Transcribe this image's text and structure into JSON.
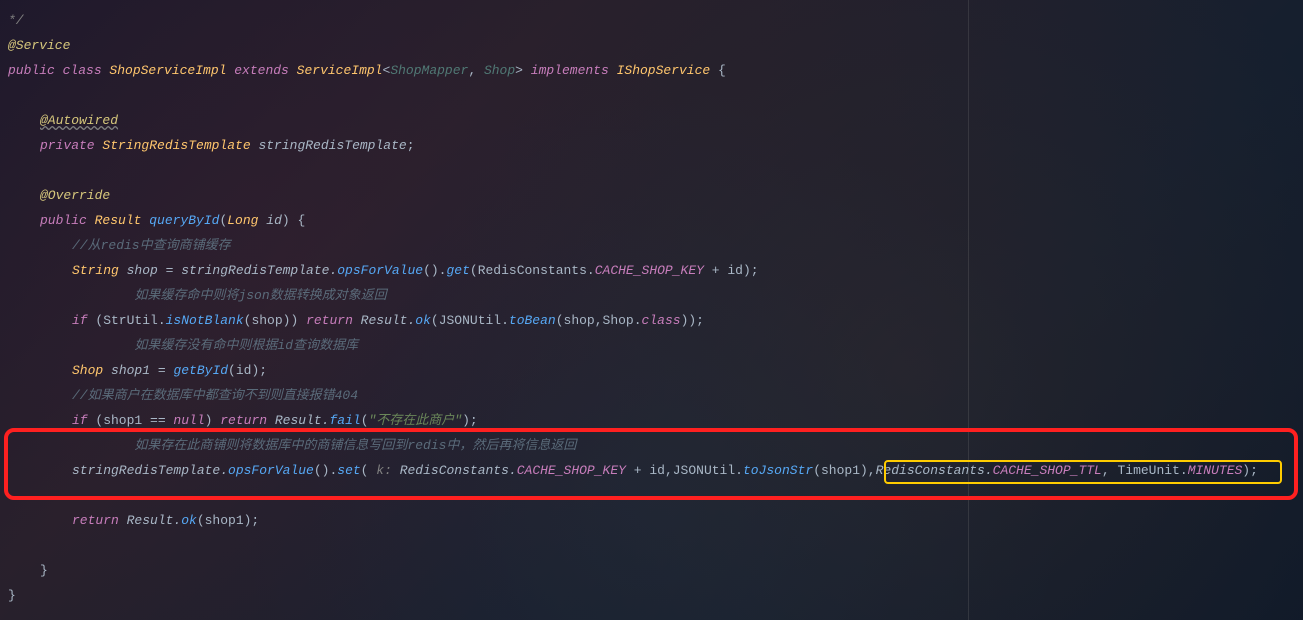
{
  "code": {
    "l1": "*/",
    "l2_anno": "@Service",
    "l3_pub": "public ",
    "l3_class": "class ",
    "l3_name": "ShopServiceImpl ",
    "l3_ext": "extends ",
    "l3_si": "ServiceImpl",
    "l3_lt": "<",
    "l3_sm": "ShopMapper",
    "l3_c1": ", ",
    "l3_shop": "Shop",
    "l3_gt": "> ",
    "l3_impl": "implements ",
    "l3_ish": "IShopService ",
    "l3_ob": "{",
    "l5_anno": "@Autowired",
    "l6_priv": "private ",
    "l6_type": "StringRedisTemplate ",
    "l6_field": "stringRedisTemplate",
    "l6_sc": ";",
    "l8_anno": "@Override",
    "l9_pub": "public ",
    "l9_ret": "Result ",
    "l9_meth": "queryById",
    "l9_op": "(",
    "l9_ptype": "Long ",
    "l9_pname": "id",
    "l9_cp": ") {",
    "l10_c": "//从redis中查询商铺缓存",
    "l11_a": "String ",
    "l11_b": "shop = stringRedisTemplate.",
    "l11_c": "opsForValue",
    "l11_d": "().",
    "l11_e": "get",
    "l11_f": "(RedisConstants.",
    "l11_g": "CACHE_SHOP_KEY",
    "l11_h": " + id);",
    "l12_slash": "//",
    "l12_c": "        如果缓存命中则将json数据转换成对象返回",
    "l13_a": "if ",
    "l13_b": "(StrUtil.",
    "l13_c": "isNotBlank",
    "l13_d": "(shop)) ",
    "l13_e": "return ",
    "l13_f": "Result.",
    "l13_g": "ok",
    "l13_h": "(JSONUtil.",
    "l13_i": "toBean",
    "l13_j": "(shop,Shop.",
    "l13_k": "class",
    "l13_l": "));",
    "l14_slash": "//",
    "l14_c": "        如果缓存没有命中则根据id查询数据库",
    "l15_a": "Shop ",
    "l15_b": "shop1 = ",
    "l15_c": "getById",
    "l15_d": "(id);",
    "l16_c": "//如果商户在数据库中都查询不到则直接报错404",
    "l17_a": "if ",
    "l17_b": "(shop1 == ",
    "l17_c": "null",
    "l17_d": ") ",
    "l17_e": "return ",
    "l17_f": "Result.",
    "l17_g": "fail",
    "l17_h": "(",
    "l17_i": "\"不存在此商户\"",
    "l17_j": ");",
    "l18_slash": "//",
    "l18_c": "        如果存在此商铺则将数据库中的商铺信息写回到redis中，然后再将信息返回",
    "l19_a": "stringRedisTemplate.",
    "l19_b": "opsForValue",
    "l19_c": "().",
    "l19_d": "set",
    "l19_e": "( ",
    "l19_hint": "k: ",
    "l19_f": "RedisConstants.",
    "l19_g": "CACHE_SHOP_KEY",
    "l19_h": " + id,JSONUtil.",
    "l19_i": "toJsonStr",
    "l19_j": "(shop1),",
    "l19_k": "RedisConstants.",
    "l19_l": "CACHE_SHOP_TTL",
    "l19_m": ", TimeUnit.",
    "l19_n": "MINUTES",
    "l19_o": ");",
    "l21_a": "return ",
    "l21_b": "Result.",
    "l21_c": "ok",
    "l21_d": "(shop1);",
    "l23": "}",
    "l24": "}"
  }
}
